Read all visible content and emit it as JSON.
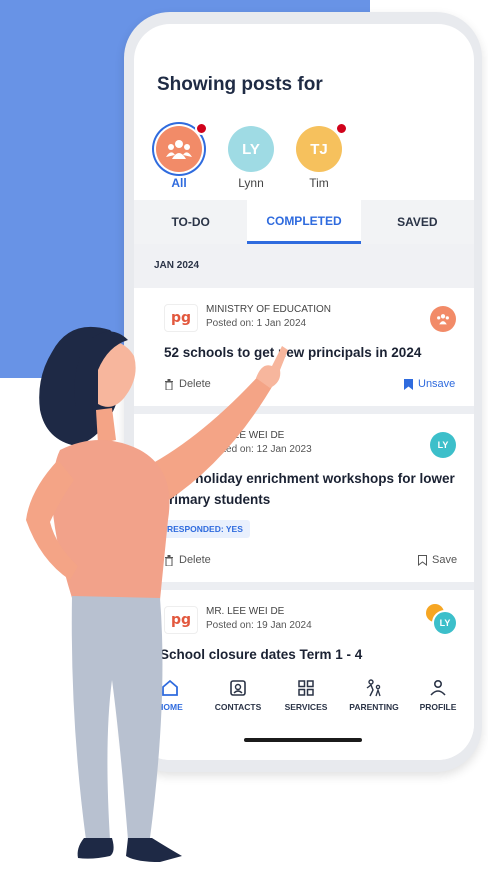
{
  "header": {
    "title": "Showing posts for"
  },
  "avatars": [
    {
      "initials": "",
      "label": "All",
      "color": "#f28b68",
      "selected": true,
      "notification": true
    },
    {
      "initials": "LY",
      "label": "Lynn",
      "color": "#9fdbe4",
      "selected": false,
      "notification": false
    },
    {
      "initials": "TJ",
      "label": "Tim",
      "color": "#f6c15d",
      "selected": false,
      "notification": true
    }
  ],
  "tabs": [
    "TO-DO",
    "COMPLETED",
    "SAVED"
  ],
  "active_tab": "COMPLETED",
  "section_label": "JAN 2024",
  "posts": [
    {
      "source": "MINISTRY OF EDUCATION",
      "posted": "Posted on: 1 Jan 2024",
      "title": "52 schools to get new principals in 2024",
      "delete_label": "Delete",
      "save_label": "Unsave",
      "avatar_initials": ""
    },
    {
      "source": "MR. LEE WEI DE",
      "posted": "Posted on: 12 Jan 2023",
      "title": "June holiday enrichment workshops for lower Primary students",
      "badge": "RESPONDED: YES",
      "delete_label": "Delete",
      "save_label": "Save",
      "avatar_initials": "LY"
    },
    {
      "source": "MR. LEE WEI DE",
      "posted": "Posted on: 19 Jan 2024",
      "title": "School closure dates Term 1 - 4",
      "avatar_initials": "LY"
    }
  ],
  "nav": [
    {
      "label": "HOME",
      "icon": "home-icon",
      "active": true
    },
    {
      "label": "CONTACTS",
      "icon": "contacts-icon",
      "active": false
    },
    {
      "label": "SERVICES",
      "icon": "grid-icon",
      "active": false
    },
    {
      "label": "PARENTING",
      "icon": "parenting-icon",
      "active": false
    },
    {
      "label": "PROFILE",
      "icon": "profile-icon",
      "active": false
    }
  ],
  "colors": {
    "accent": "#2f6bde",
    "background": "#6893e6",
    "orange": "#f28b68",
    "teal": "#3cbfca"
  }
}
